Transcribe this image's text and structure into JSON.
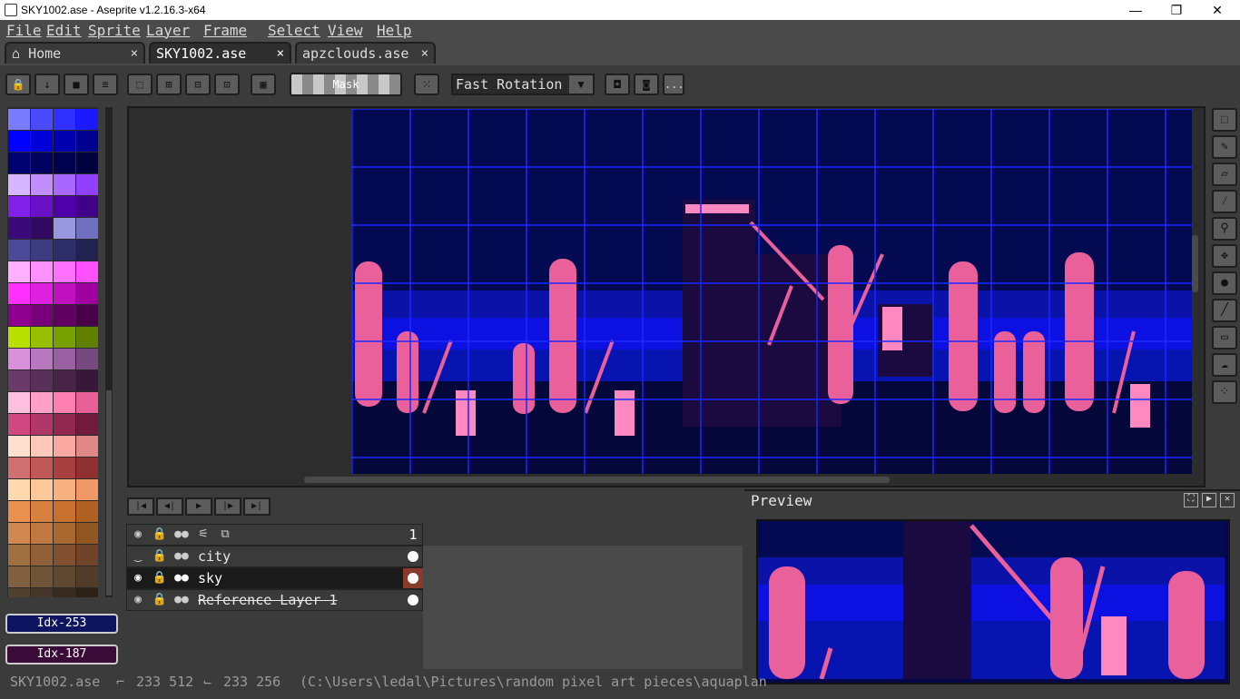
{
  "window": {
    "title": "SKY1002.ase - Aseprite v1.2.16.3-x64",
    "minimize": "—",
    "maximize": "❐",
    "close": "✕"
  },
  "menu": [
    "File",
    "Edit",
    "Sprite",
    "Layer",
    "Frame",
    "Select",
    "View",
    "Help"
  ],
  "tabs": [
    {
      "label": "Home",
      "icon": "home-icon",
      "close": "×"
    },
    {
      "label": "SKY1002.ase",
      "close": "×",
      "active": true
    },
    {
      "label": "apzclouds.ase",
      "close": "×"
    }
  ],
  "toolbar": {
    "mask_label": "Mask",
    "rotation_value": "Fast Rotation",
    "more": "..."
  },
  "colors": {
    "fg_index": "Idx-253",
    "bg_index": "Idx-187",
    "fg_color": "#0e1560",
    "bg_color": "#3a0a38"
  },
  "palette": [
    "#7a7cff",
    "#4a4aff",
    "#2e30ff",
    "#1a1aff",
    "#0000ff",
    "#0000d8",
    "#0000b0",
    "#000090",
    "#000070",
    "#000060",
    "#000050",
    "#000040",
    "#d6b6ff",
    "#c08eff",
    "#a868ff",
    "#9040ff",
    "#8020e8",
    "#6a10c8",
    "#5000a8",
    "#400088",
    "#3c0a78",
    "#300a60",
    "#9898e0",
    "#7070c0",
    "#4a4a98",
    "#3c3c80",
    "#2e2e68",
    "#222250",
    "#ffb0ff",
    "#ff90ff",
    "#ff70ff",
    "#ff50ff",
    "#ff30ff",
    "#e020e0",
    "#c010c0",
    "#a000a0",
    "#900090",
    "#780078",
    "#600060",
    "#480048",
    "#b8e000",
    "#98c000",
    "#78a000",
    "#608000",
    "#d890d8",
    "#b878c0",
    "#9860a0",
    "#784880",
    "#6a3a6a",
    "#583058",
    "#482448",
    "#381838",
    "#ffc0e0",
    "#ffa0c8",
    "#ff80b0",
    "#e86098",
    "#d04880",
    "#b03868",
    "#902850",
    "#701a3c",
    "#ffe0d0",
    "#ffc8b8",
    "#f8a8a0",
    "#e08888",
    "#d07070",
    "#c05858",
    "#a84040",
    "#903030",
    "#ffd8b0",
    "#ffc898",
    "#f8b080",
    "#f09868",
    "#e89050",
    "#d88040",
    "#c87030",
    "#b06020",
    "#d08850",
    "#c07840",
    "#a86830",
    "#905820",
    "#a07040",
    "#906038",
    "#805030",
    "#704428",
    "#806040",
    "#705438",
    "#604830",
    "#503c28",
    "#504030",
    "#443628",
    "#382c20",
    "#2c2218"
  ],
  "playback": [
    "|◀",
    "◀|",
    "▶",
    "|▶",
    "▶|"
  ],
  "timeline": {
    "frame_number": "1",
    "layers": [
      {
        "name": "city",
        "visible": false,
        "selected": false,
        "strike": false
      },
      {
        "name": "sky",
        "visible": true,
        "selected": true,
        "strike": false
      },
      {
        "name": "Reference Layer 1",
        "visible": true,
        "selected": false,
        "strike": true
      }
    ]
  },
  "preview": {
    "title": "Preview",
    "btn_center": "⛶",
    "btn_play": "▶",
    "btn_close": "✕"
  },
  "status": {
    "file": "SKY1002.ase",
    "size": "233 512",
    "size2": "233 256",
    "path": "(C:\\Users\\ledal\\Pictures\\random pixel art pieces\\aquaplan"
  }
}
